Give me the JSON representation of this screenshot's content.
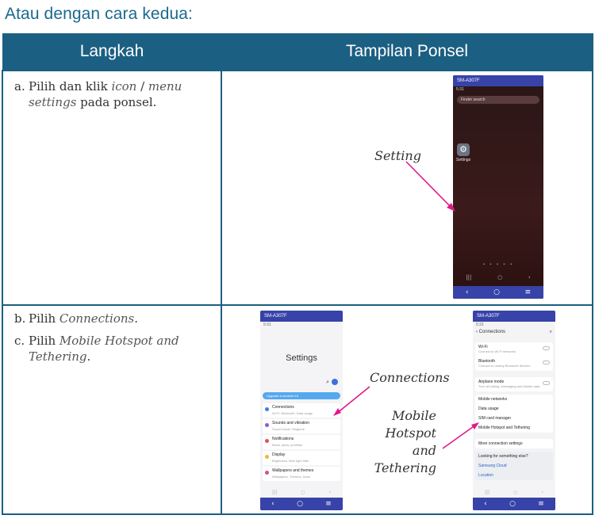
{
  "heading": "Atau dengan cara kedua:",
  "table": {
    "col1_header": "Langkah",
    "col2_header": "Tampilan Ponsel"
  },
  "row1": {
    "step_a_num": "a.",
    "step_a_pre": "Pilih dan klik ",
    "step_a_icon": "icon",
    "step_a_slash": " / ",
    "step_a_menu": "menu settings",
    "step_a_post": " pada ponsel.",
    "annotation": "Setting",
    "phone": {
      "title_bar": "SM-A307F",
      "status": "5:31",
      "search_placeholder": "Finder search",
      "app_label": "Settings"
    }
  },
  "row2": {
    "step_b_num": "b.",
    "step_b_pre": "Pilih ",
    "step_b_it": "Connections",
    "step_b_post": ".",
    "step_c_num": "c.",
    "step_c_pre": "Pilih ",
    "step_c_it": "Mobile Hotspot and Tethering",
    "step_c_post": ".",
    "annotation_1": "Connections",
    "annotation_2_l1": "Mobile",
    "annotation_2_l2": "Hotspot and",
    "annotation_2_l3": "Tethering",
    "phone_settings": {
      "title_bar": "SM-A307F",
      "title": "Settings",
      "banner": "Upgrade to Android 10",
      "items": [
        {
          "label": "Connections",
          "sub": "Wi-Fi, Bluetooth, Data usage",
          "color": "#3d7fe0"
        },
        {
          "label": "Sounds and vibration",
          "sub": "Sound mode, Ringtone",
          "color": "#8a5ad6"
        },
        {
          "label": "Notifications",
          "sub": "Block, allow, prioritise",
          "color": "#e0534a"
        },
        {
          "label": "Display",
          "sub": "Brightness, Blue light filter",
          "color": "#f2b631"
        },
        {
          "label": "Wallpapers and themes",
          "sub": "Wallpapers, Themes, Icons",
          "color": "#d44f8e"
        }
      ]
    },
    "phone_connections": {
      "title_bar": "SM-A307F",
      "header": "Connections",
      "group1": [
        {
          "label": "Wi-Fi",
          "sub": "Connect to Wi-Fi networks"
        },
        {
          "label": "Bluetooth",
          "sub": "Connect to nearby Bluetooth devices"
        }
      ],
      "group2": [
        {
          "label": "Airplane mode",
          "sub": "Turn off calling, messaging and Mobile data"
        }
      ],
      "group3": [
        {
          "label": "Mobile networks"
        },
        {
          "label": "Data usage"
        },
        {
          "label": "SIM card manager"
        },
        {
          "label": "Mobile Hotspot and Tethering"
        }
      ],
      "more": "More connection settings",
      "group4_title": "Looking for something else?",
      "group4_links": [
        "Samsung Cloud",
        "Location"
      ]
    }
  }
}
